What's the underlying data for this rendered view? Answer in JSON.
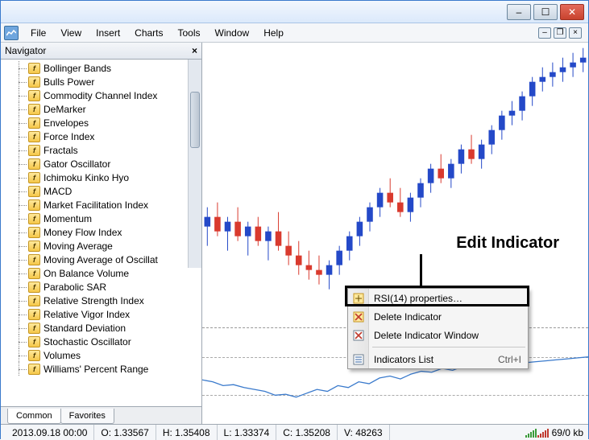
{
  "titlebar": {
    "min": "–",
    "max": "☐",
    "close": "✕"
  },
  "menubar": {
    "items": [
      "File",
      "View",
      "Insert",
      "Charts",
      "Tools",
      "Window",
      "Help"
    ],
    "mini": {
      "min": "‒",
      "restore": "❐",
      "close": "×"
    }
  },
  "navigator": {
    "title": "Navigator",
    "close": "×",
    "items": [
      "Bollinger Bands",
      "Bulls Power",
      "Commodity Channel Index",
      "DeMarker",
      "Envelopes",
      "Force Index",
      "Fractals",
      "Gator Oscillator",
      "Ichimoku Kinko Hyo",
      "MACD",
      "Market Facilitation Index",
      "Momentum",
      "Money Flow Index",
      "Moving Average",
      "Moving Average of Oscillat",
      "On Balance Volume",
      "Parabolic SAR",
      "Relative Strength Index",
      "Relative Vigor Index",
      "Standard Deviation",
      "Stochastic Oscillator",
      "Volumes",
      "Williams' Percent Range"
    ],
    "tabs": {
      "common": "Common",
      "favorites": "Favorites"
    }
  },
  "context_menu": {
    "properties": "RSI(14) properties…",
    "delete_ind": "Delete Indicator",
    "delete_win": "Delete Indicator Window",
    "list": "Indicators List",
    "list_sc": "Ctrl+I"
  },
  "annotation": {
    "label": "Edit Indicator"
  },
  "statusbar": {
    "date": "2013.09.18 00:00",
    "o": "O: 1.33567",
    "h": "H: 1.35408",
    "l": "L: 1.33374",
    "c": "C: 1.35208",
    "v": "V: 48263",
    "conn": "69/0 kb"
  },
  "chart_data": {
    "main": {
      "type": "candlestick",
      "note": "approximate OHLC bars read from pixels; color=up(blue)/down(red)",
      "candles": [
        {
          "o": 26,
          "h": 34,
          "l": 18,
          "c": 30,
          "d": "u"
        },
        {
          "o": 30,
          "h": 36,
          "l": 22,
          "c": 24,
          "d": "d"
        },
        {
          "o": 24,
          "h": 30,
          "l": 16,
          "c": 28,
          "d": "u"
        },
        {
          "o": 28,
          "h": 34,
          "l": 20,
          "c": 22,
          "d": "d"
        },
        {
          "o": 22,
          "h": 28,
          "l": 14,
          "c": 26,
          "d": "u"
        },
        {
          "o": 26,
          "h": 30,
          "l": 18,
          "c": 20,
          "d": "d"
        },
        {
          "o": 20,
          "h": 26,
          "l": 12,
          "c": 24,
          "d": "u"
        },
        {
          "o": 24,
          "h": 32,
          "l": 16,
          "c": 18,
          "d": "d"
        },
        {
          "o": 18,
          "h": 24,
          "l": 10,
          "c": 14,
          "d": "d"
        },
        {
          "o": 14,
          "h": 20,
          "l": 6,
          "c": 10,
          "d": "d"
        },
        {
          "o": 10,
          "h": 16,
          "l": 4,
          "c": 8,
          "d": "d"
        },
        {
          "o": 8,
          "h": 14,
          "l": 2,
          "c": 6,
          "d": "d"
        },
        {
          "o": 6,
          "h": 12,
          "l": 0,
          "c": 10,
          "d": "u"
        },
        {
          "o": 10,
          "h": 18,
          "l": 6,
          "c": 16,
          "d": "u"
        },
        {
          "o": 16,
          "h": 24,
          "l": 12,
          "c": 22,
          "d": "u"
        },
        {
          "o": 22,
          "h": 30,
          "l": 18,
          "c": 28,
          "d": "u"
        },
        {
          "o": 28,
          "h": 36,
          "l": 24,
          "c": 34,
          "d": "u"
        },
        {
          "o": 34,
          "h": 42,
          "l": 30,
          "c": 40,
          "d": "u"
        },
        {
          "o": 40,
          "h": 46,
          "l": 34,
          "c": 36,
          "d": "d"
        },
        {
          "o": 36,
          "h": 42,
          "l": 30,
          "c": 32,
          "d": "d"
        },
        {
          "o": 32,
          "h": 40,
          "l": 28,
          "c": 38,
          "d": "u"
        },
        {
          "o": 38,
          "h": 46,
          "l": 34,
          "c": 44,
          "d": "u"
        },
        {
          "o": 44,
          "h": 52,
          "l": 40,
          "c": 50,
          "d": "u"
        },
        {
          "o": 50,
          "h": 56,
          "l": 44,
          "c": 46,
          "d": "d"
        },
        {
          "o": 46,
          "h": 54,
          "l": 42,
          "c": 52,
          "d": "u"
        },
        {
          "o": 52,
          "h": 60,
          "l": 48,
          "c": 58,
          "d": "u"
        },
        {
          "o": 58,
          "h": 64,
          "l": 52,
          "c": 54,
          "d": "d"
        },
        {
          "o": 54,
          "h": 62,
          "l": 50,
          "c": 60,
          "d": "u"
        },
        {
          "o": 60,
          "h": 68,
          "l": 56,
          "c": 66,
          "d": "u"
        },
        {
          "o": 66,
          "h": 74,
          "l": 62,
          "c": 72,
          "d": "u"
        },
        {
          "o": 72,
          "h": 78,
          "l": 68,
          "c": 74,
          "d": "u"
        },
        {
          "o": 74,
          "h": 82,
          "l": 70,
          "c": 80,
          "d": "u"
        },
        {
          "o": 80,
          "h": 88,
          "l": 76,
          "c": 86,
          "d": "u"
        },
        {
          "o": 86,
          "h": 92,
          "l": 82,
          "c": 88,
          "d": "u"
        },
        {
          "o": 88,
          "h": 94,
          "l": 84,
          "c": 90,
          "d": "u"
        },
        {
          "o": 90,
          "h": 96,
          "l": 86,
          "c": 92,
          "d": "u"
        },
        {
          "o": 92,
          "h": 98,
          "l": 88,
          "c": 94,
          "d": "u"
        },
        {
          "o": 94,
          "h": 100,
          "l": 90,
          "c": 96,
          "d": "u"
        }
      ],
      "y_range": [
        0,
        100
      ]
    },
    "rsi": {
      "type": "line",
      "levels": [
        30,
        70
      ],
      "values": [
        46,
        44,
        40,
        41,
        38,
        36,
        34,
        30,
        31,
        28,
        32,
        36,
        34,
        40,
        38,
        44,
        42,
        48,
        50,
        47,
        52,
        55,
        54,
        58,
        56,
        60,
        59,
        62,
        61,
        63,
        62,
        64,
        65,
        66,
        67,
        68,
        69,
        70
      ],
      "y_range": [
        0,
        100
      ]
    }
  }
}
